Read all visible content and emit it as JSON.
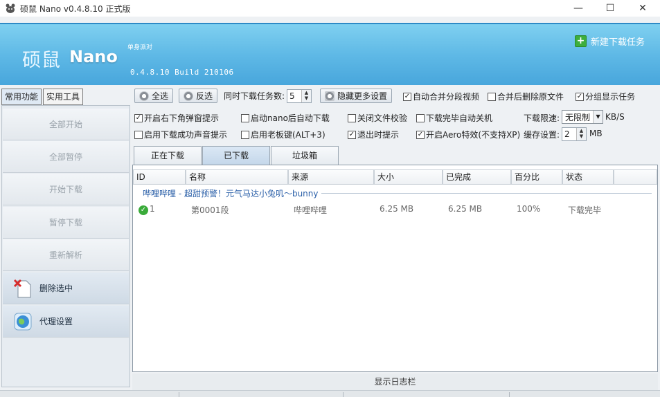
{
  "window": {
    "title": "硕鼠 Nano v0.4.8.10 正式版"
  },
  "banner": {
    "brand_cn": "硕鼠",
    "brand_en": "Nano",
    "slogan": "单身派对",
    "build": "0.4.8.10 Build 210106",
    "new_task": "新建下载任务"
  },
  "sidebar": {
    "tabs": [
      "常用功能",
      "实用工具"
    ],
    "buttons": [
      "全部开始",
      "全部暂停",
      "开始下载",
      "暂停下载",
      "重新解析",
      "删除选中",
      "代理设置"
    ]
  },
  "toolbar": {
    "select_all": "全选",
    "invert": "反选",
    "concurrent_label": "同时下载任务数:",
    "concurrent_value": "5",
    "hide_more": "隐藏更多设置",
    "auto_merge": "自动合并分段视频",
    "delete_after_merge": "合并后删除原文件",
    "group_display": "分组显示任务"
  },
  "options": {
    "popup": "开启右下角弹窗提示",
    "autostart": "启动nano后自动下载",
    "close_verify": "关闭文件校验",
    "shutdown": "下载完毕自动关机",
    "speed_label": "下载限速:",
    "speed_value": "无限制",
    "speed_unit": "KB/S",
    "sound": "启用下载成功声音提示",
    "boss_key": "启用老板键(ALT+3)",
    "exit_prompt": "退出时提示",
    "aero": "开启Aero特效(不支持XP)",
    "cache_label": "缓存设置:",
    "cache_value": "2",
    "cache_unit": "MB"
  },
  "content_tabs": [
    "正在下载",
    "已下载",
    "垃圾箱"
  ],
  "table": {
    "headers": [
      "ID",
      "名称",
      "来源",
      "大小",
      "已完成",
      "百分比",
      "状态"
    ],
    "group": "哔哩哔哩 - 超甜预警！元气马达小兔叽～bunny",
    "rows": [
      {
        "id": "1",
        "name": "第0001段",
        "source": "哔哩哔哩",
        "size": "6.25 MB",
        "done": "6.25 MB",
        "percent": "100%",
        "status": "下载完毕"
      }
    ]
  },
  "log_label": "显示日志栏"
}
